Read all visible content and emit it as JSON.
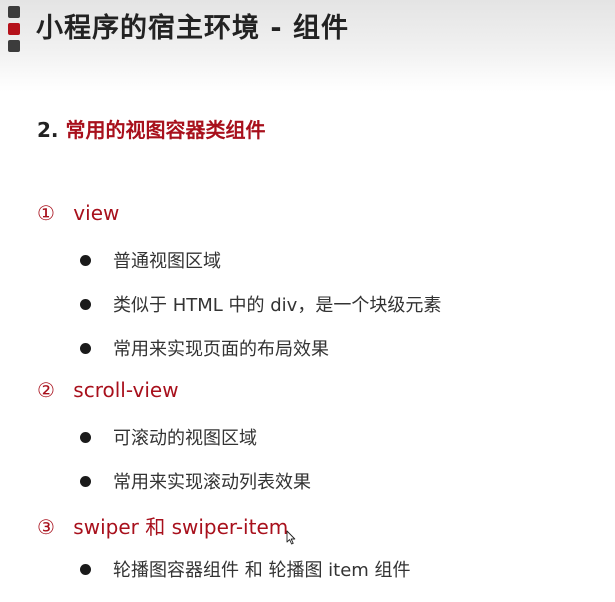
{
  "header": {
    "title": "小程序的宿主环境 - 组件"
  },
  "section": {
    "number": "2.",
    "title": "常用的视图容器类组件"
  },
  "items": [
    {
      "marker": "①",
      "name": "view",
      "bullets": [
        "普通视图区域",
        "类似于 HTML 中的 div，是一个块级元素",
        "常用来实现页面的布局效果"
      ]
    },
    {
      "marker": "②",
      "name": "scroll-view",
      "bullets": [
        "可滚动的视图区域",
        "常用来实现滚动列表效果"
      ]
    },
    {
      "marker": "③",
      "name": "swiper 和 swiper-item",
      "bullets": [
        "轮播图容器组件 和 轮播图 item 组件"
      ]
    }
  ],
  "colors": {
    "accent": "#a8101c",
    "text": "#333333",
    "header_bg": "#ececec"
  }
}
